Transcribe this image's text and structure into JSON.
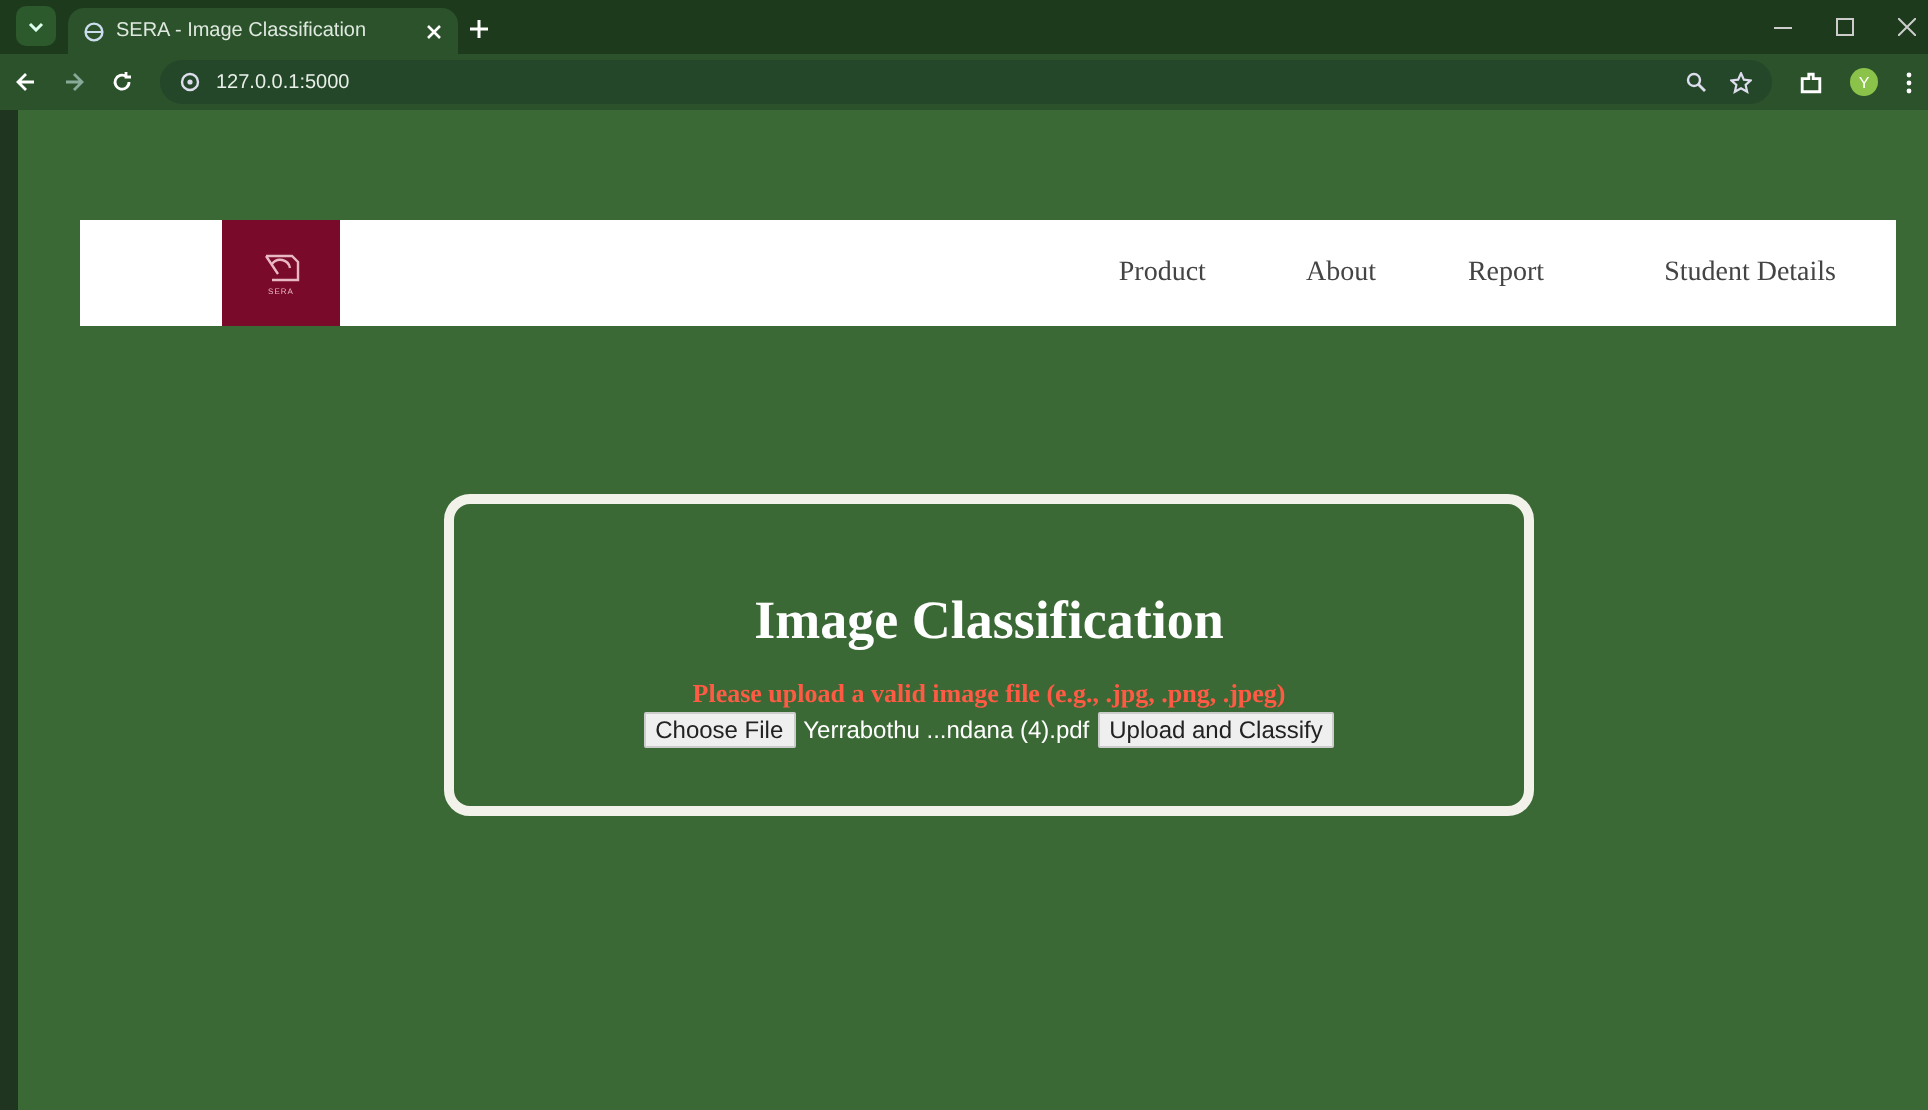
{
  "browser": {
    "tab_title": "SERA - Image Classification",
    "address": "127.0.0.1:5000",
    "profile_initial": "Y"
  },
  "nav": {
    "logo_text": "SERA",
    "links": [
      {
        "label": "Product"
      },
      {
        "label": "About"
      },
      {
        "label": "Report"
      },
      {
        "label": "Student Details"
      }
    ]
  },
  "card": {
    "title": "Image Classification",
    "error": "Please upload a valid image file (e.g., .jpg, .png, .jpeg)",
    "choose_button": "Choose File",
    "file_name": "Yerrabothu ...ndana (4).pdf",
    "upload_button": "Upload and Classify"
  }
}
